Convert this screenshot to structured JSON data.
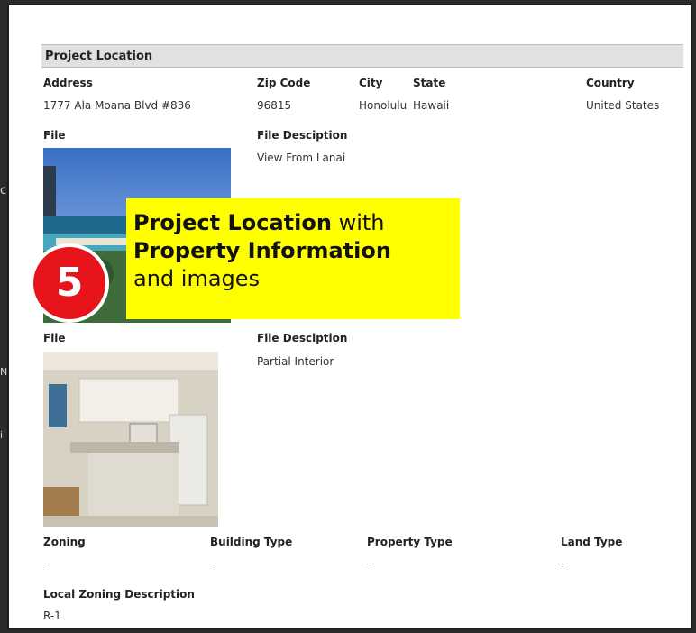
{
  "section": {
    "title": "Project Location"
  },
  "location": {
    "headers": {
      "address": "Address",
      "zip": "Zip Code",
      "city": "City",
      "state": "State",
      "country": "Country"
    },
    "values": {
      "address": "1777 Ala Moana Blvd #836",
      "zip": "96815",
      "city": "Honolulu",
      "state": "Hawaii",
      "country": "United States"
    }
  },
  "files": [
    {
      "file_label": "File",
      "desc_label": "File Desciption",
      "description": "View From Lanai",
      "image_icon": "ocean-view-photo-icon"
    },
    {
      "file_label": "File",
      "desc_label": "File Desciption",
      "description": "Partial Interior",
      "image_icon": "kitchen-interior-photo-icon"
    }
  ],
  "property": {
    "headers": {
      "zoning": "Zoning",
      "building_type": "Building Type",
      "property_type": "Property Type",
      "land_type": "Land Type"
    },
    "values": {
      "zoning": "-",
      "building_type": "-",
      "property_type": "-",
      "land_type": "-"
    }
  },
  "local_zoning": {
    "label": "Local Zoning Description",
    "value": "R-1"
  },
  "callout": {
    "number": "5",
    "bold1": "Project Location",
    "rest1": " with",
    "bold2": "Property Information",
    "rest2": "and  images",
    "color": "#ffff00"
  },
  "badge_color": "#e8141b"
}
